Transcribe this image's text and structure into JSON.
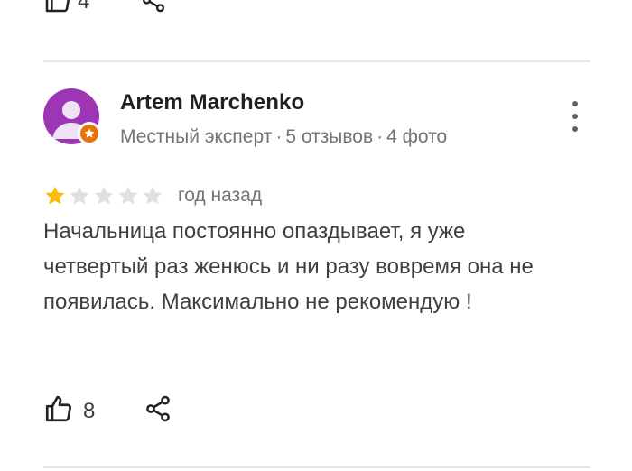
{
  "previous_review": {
    "like_count": "4",
    "like_icon": "thumb-up-icon",
    "share_icon": "share-icon"
  },
  "review": {
    "author": {
      "name": "Artem Marchenko",
      "status": "Местный эксперт",
      "reviews": "5 отзывов",
      "photos": "4 фото",
      "separator": "·",
      "avatar_icon": "person-avatar-icon",
      "badge_icon": "local-guide-badge-icon",
      "avatar_color": "#9c36b5",
      "badge_color": "#e8710a"
    },
    "rating": {
      "value": 1,
      "max": 5,
      "filled_color": "#fbbc04",
      "empty_color": "#e0e0e0"
    },
    "time": "год назад",
    "text": "Начальница постоянно опаздывает, я уже четвертый раз женюсь и ни разу вовремя она не появилась. Максимально не рекомендую !",
    "like_count": "8",
    "more_icon": "more-vert-icon",
    "like_icon": "thumb-up-icon",
    "share_icon": "share-icon"
  }
}
